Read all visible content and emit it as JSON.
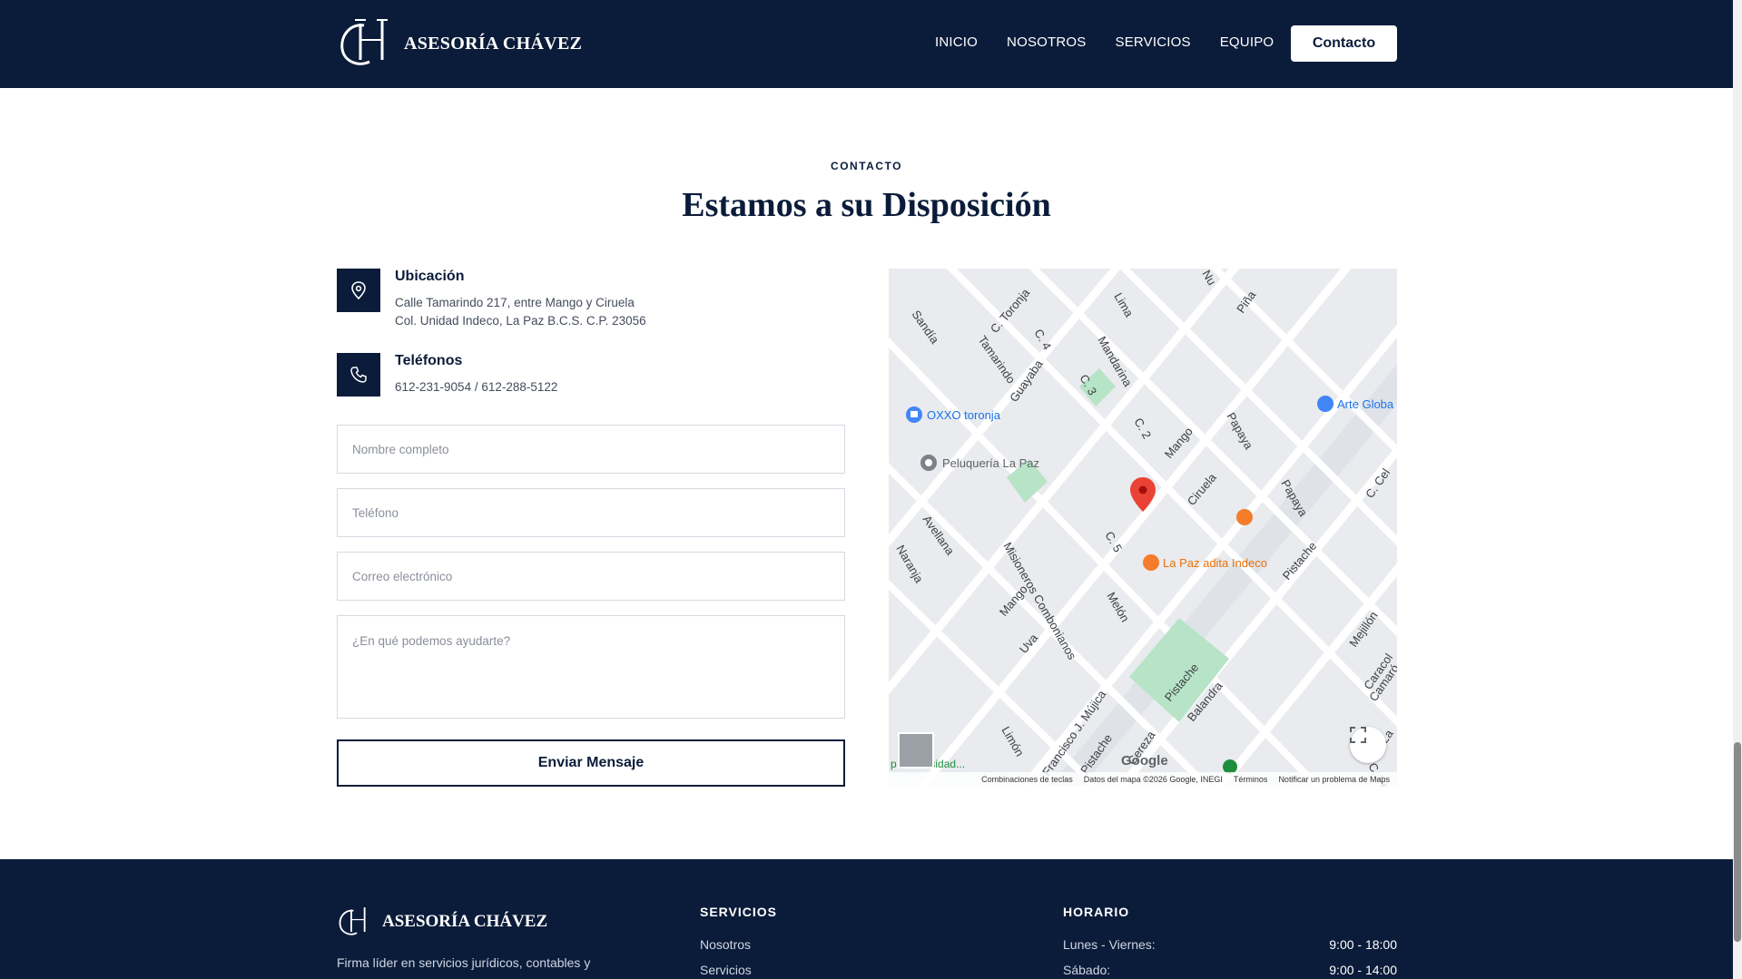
{
  "nav": {
    "brand": "ASESORÍA CHÁVEZ",
    "links": [
      "INICIO",
      "NOSOTROS",
      "SERVICIOS",
      "EQUIPO"
    ],
    "cta": "Contacto"
  },
  "section": {
    "eyebrow": "CONTACTO",
    "title": "Estamos a su Disposición"
  },
  "info": {
    "location": {
      "title": "Ubicación",
      "line1": "Calle Tamarindo 217, entre Mango y Ciruela",
      "line2": "Col. Unidad Indeco, La Paz B.C.S. C.P. 23056",
      "icon": "map-pin-icon"
    },
    "phones": {
      "title": "Teléfonos",
      "line1": "612-231-9054 / 612-288-5122",
      "icon": "phone-icon"
    }
  },
  "form": {
    "name_placeholder": "Nombre completo",
    "phone_placeholder": "Teléfono",
    "email_placeholder": "Correo electrónico",
    "message_placeholder": "¿En qué podemos ayudarte?",
    "submit": "Enviar Mensaje"
  },
  "map": {
    "streets": [
      "Lima",
      "Nu",
      "Piña",
      "C. Toronja",
      "Sandía",
      "C. 4",
      "Tamarindo",
      "Mandarina",
      "Guayaba",
      "C. 3",
      "C. 2",
      "Mango",
      "Papaya",
      "Ciruela",
      "Papaya",
      "C. Cel",
      "Avellana",
      "C. 5",
      "Naranja",
      "Misioneros Combonianos",
      "Mango",
      "Melón",
      "Pistache",
      "Uva",
      "Mejillón",
      "Caracol",
      "Pistache",
      "Balandra",
      "Camaró",
      "Limón",
      "Francisco J. Mújica",
      "Pistache",
      "Cereza",
      "La",
      "C. Pe"
    ],
    "places": {
      "oxxo": "OXXO toronja",
      "peluqueria": "Peluquería La Paz",
      "restaurant": "La Paz adita Indeco",
      "arte": "Arte Globa"
    },
    "partial_label": "p      tbol\nersidad...",
    "google": "Google",
    "footer": {
      "shortcuts": "Combinaciones de teclas",
      "mapdata": "Datos del mapa ©2026 Google, INEGI",
      "terms": "Términos",
      "report": "Notificar un problema de Maps"
    },
    "colors": {
      "base": "#e9ebee",
      "road": "#ffffff",
      "park": "#b7e4c7",
      "pin": "#ea4335",
      "food": "#f57c2b",
      "shop": "#4285f4"
    }
  },
  "footer": {
    "brand": "ASESORÍA CHÁVEZ",
    "desc": "Firma líder en servicios jurídicos, contables y",
    "services_heading": "SERVICIOS",
    "services_links": [
      "Nosotros",
      "Servicios"
    ],
    "hours_heading": "HORARIO",
    "hours": [
      {
        "day": "Lunes - Viernes:",
        "time": "9:00 - 18:00"
      },
      {
        "day": "Sábado:",
        "time": "9:00 - 14:00"
      }
    ]
  },
  "colors": {
    "navy": "#0b1c3a",
    "white": "#ffffff"
  }
}
